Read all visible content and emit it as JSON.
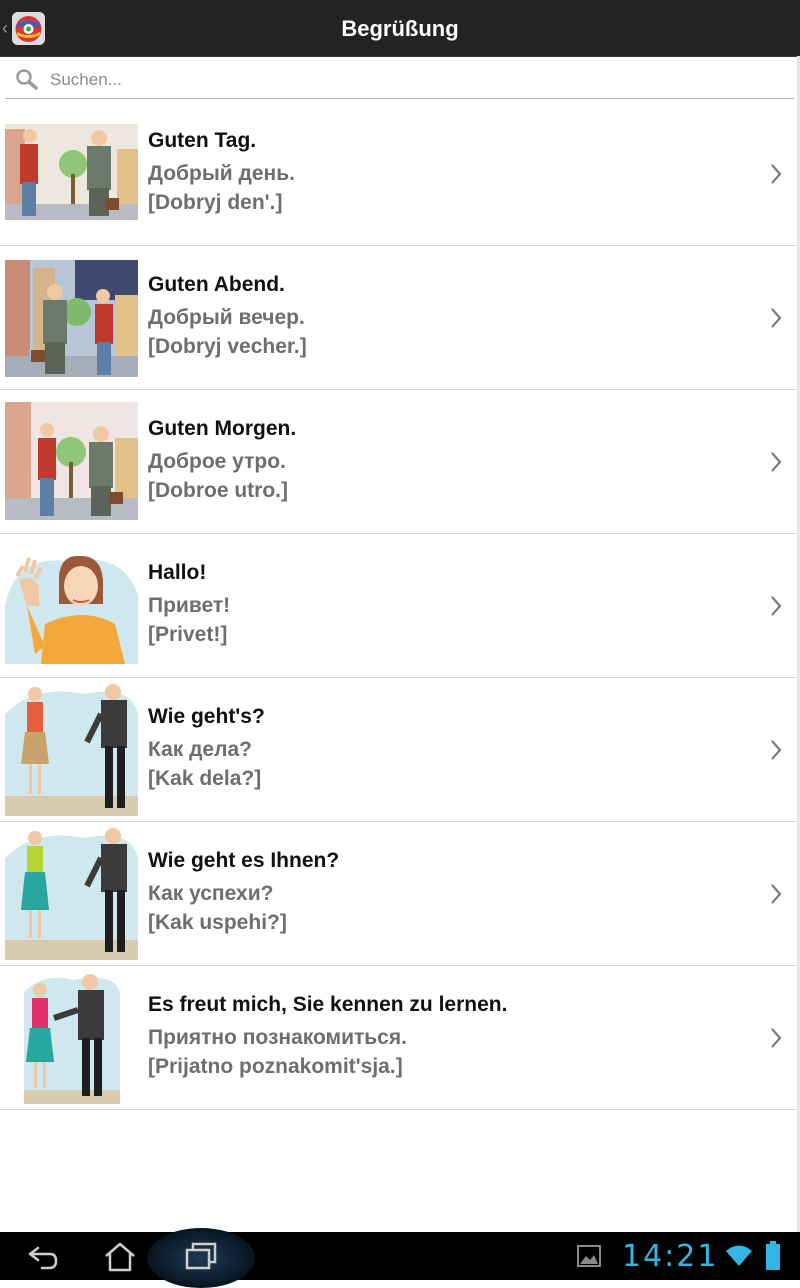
{
  "actionbar": {
    "title": "Begrüßung",
    "icon": "app-globe-icon"
  },
  "search": {
    "placeholder": "Suchen...",
    "value": ""
  },
  "items": [
    {
      "de": "Guten Tag.",
      "ru": "Добрый день.",
      "translit": "[Dobryj den'.]",
      "image": "handshake-day"
    },
    {
      "de": "Guten Abend.",
      "ru": "Добрый вечер.",
      "translit": "[Dobryj vecher.]",
      "image": "handshake-evening"
    },
    {
      "de": "Guten Morgen.",
      "ru": "Доброе утро.",
      "translit": "[Dobroe utro.]",
      "image": "handshake-morning"
    },
    {
      "de": "Hallo!",
      "ru": "Привет!",
      "translit": "[Privet!]",
      "image": "woman-waving"
    },
    {
      "de": "Wie geht's?",
      "ru": "Как дела?",
      "translit": "[Kak dela?]",
      "image": "woman-man-greeting"
    },
    {
      "de": "Wie geht es Ihnen?",
      "ru": "Как успехи?",
      "translit": "[Kak uspehi?]",
      "image": "woman-man-greeting-2"
    },
    {
      "de": "Es freut mich, Sie kennen zu lernen.",
      "ru": "Приятно познакомиться.",
      "translit": "[Prijatno poznakomit'sja.]",
      "image": "woman-man-handshake"
    }
  ],
  "statusbar": {
    "time": "14:21",
    "icons": [
      "gallery-icon",
      "wifi-icon",
      "battery-icon"
    ]
  },
  "navbar": {
    "buttons": [
      "back-icon",
      "home-icon",
      "recent-apps-icon"
    ]
  },
  "colors": {
    "actionbar": "#232323",
    "accent_clock": "#33b5e5",
    "translation_text": "#6e6e6e"
  }
}
